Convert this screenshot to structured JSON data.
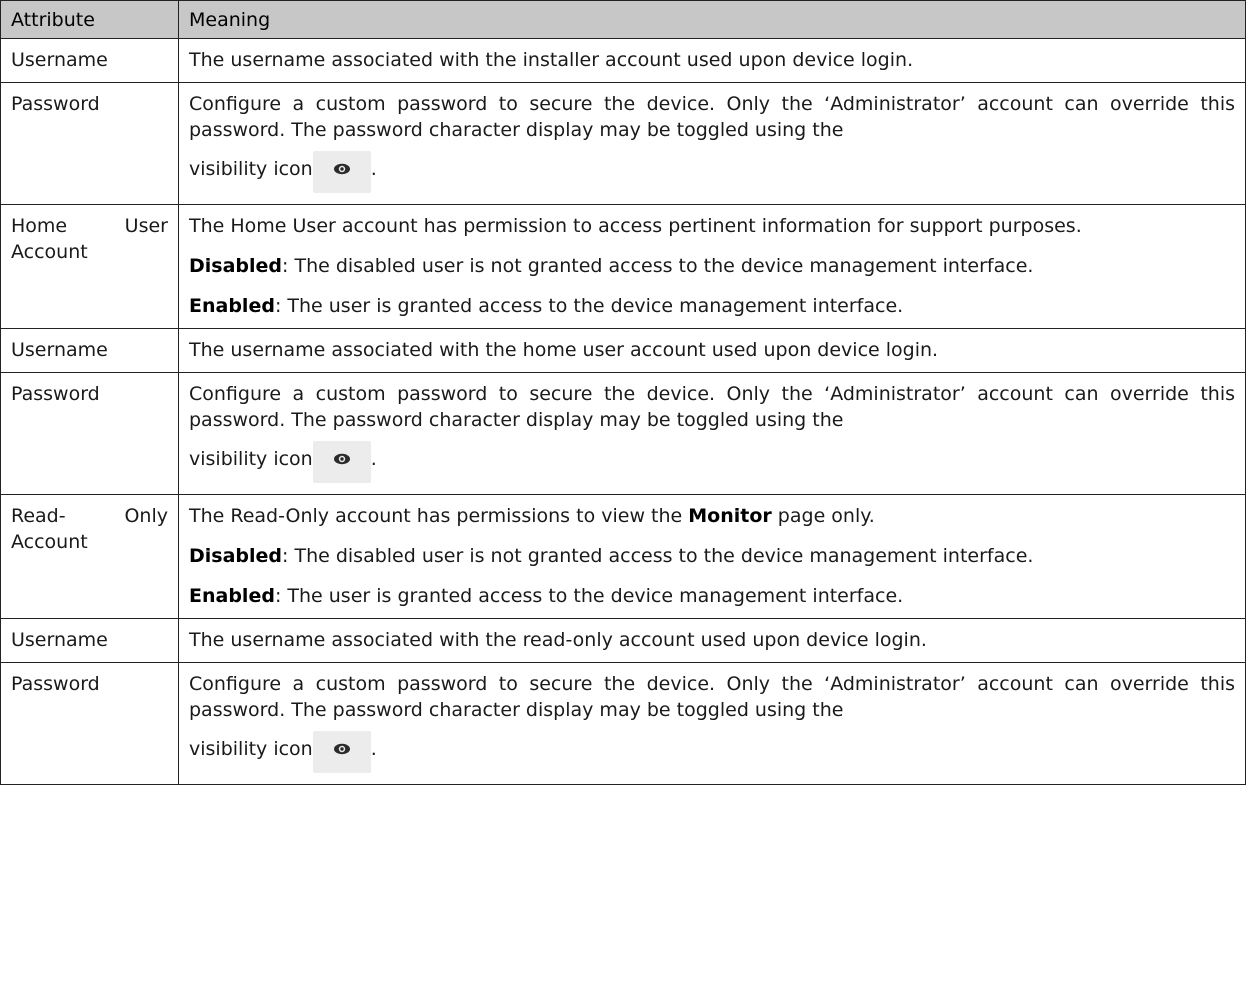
{
  "table": {
    "headers": [
      "Attribute",
      "Meaning"
    ],
    "rows": [
      {
        "attribute": "Username",
        "meaning": "The username associated with the installer account used upon device login."
      },
      {
        "attribute": "Password",
        "meaning_lead": "Configure a custom password to secure the device. Only the ‘Administrator’ account can override this password. The password character display may be toggled using the",
        "meaning_tail": "visibility icon",
        "meaning_end": ".",
        "icon": "eye-icon"
      },
      {
        "attribute": "Home User Account",
        "meaning": "The Home User account has permission to access pertinent information for support purposes.",
        "disabled_label": "Disabled",
        "disabled_text": ": The disabled user is not granted access to the device management interface.",
        "enabled_label": "Enabled",
        "enabled_text": ": The user is granted access to the device management interface."
      },
      {
        "attribute": "Username",
        "meaning": "The username associated with the home user account used upon device login."
      },
      {
        "attribute": "Password",
        "meaning_lead": "Configure a custom password to secure the device. Only the ‘Administrator’ account can override this password. The password character display may be toggled using the",
        "meaning_tail": "visibility icon",
        "meaning_end": ".",
        "icon": "eye-icon"
      },
      {
        "attribute": "Read- Only Account",
        "meaning_pre": "The Read-Only account has permissions to view the ",
        "meaning_bold": "Monitor",
        "meaning_post": " page only.",
        "disabled_label": "Disabled",
        "disabled_text": ": The disabled user is not granted access to the device management interface.",
        "enabled_label": "Enabled",
        "enabled_text": ": The user is granted access to the device management interface."
      },
      {
        "attribute": "Username",
        "meaning": "The username associated with the read-only account used upon device login."
      },
      {
        "attribute": "Password",
        "meaning_lead": "Configure a custom password to secure the device. Only the ‘Administrator’ account can override this password. The password character display may be toggled using the",
        "meaning_tail": "visibility icon",
        "meaning_end": ".",
        "icon": "eye-icon"
      }
    ]
  }
}
